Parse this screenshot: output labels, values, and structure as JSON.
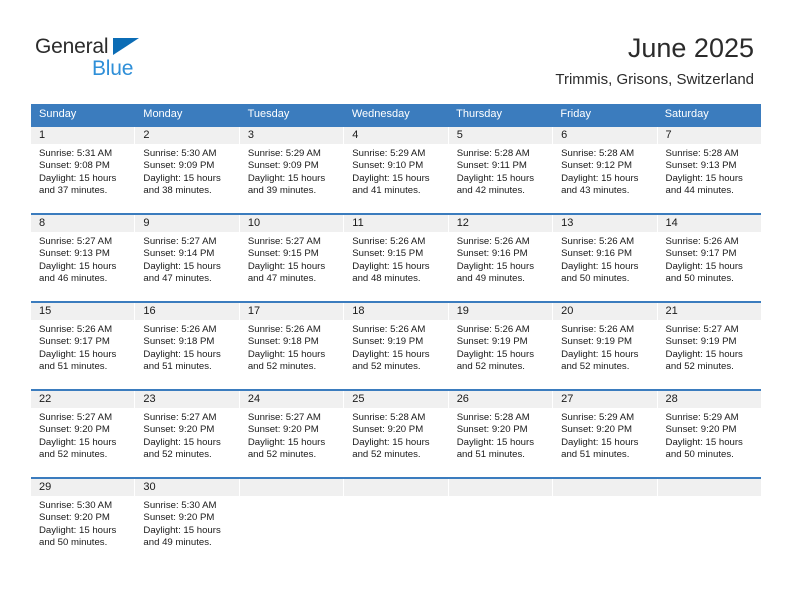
{
  "brand": {
    "name_part1": "General",
    "name_part2": "Blue",
    "triangle_color": "#0b6cb5",
    "blue_text_color": "#2f8fd8"
  },
  "header": {
    "title": "June 2025",
    "subtitle": "Trimmis, Grisons, Switzerland"
  },
  "theme": {
    "header_blue": "#3b7cbe",
    "daynum_band": "#f0f0f0",
    "text": "#1a1a1a"
  },
  "weekdays": [
    "Sunday",
    "Monday",
    "Tuesday",
    "Wednesday",
    "Thursday",
    "Friday",
    "Saturday"
  ],
  "weeks": [
    [
      {
        "day": "1",
        "sunrise": "Sunrise: 5:31 AM",
        "sunset": "Sunset: 9:08 PM",
        "daylight_line1": "Daylight: 15 hours",
        "daylight_line2": "and 37 minutes."
      },
      {
        "day": "2",
        "sunrise": "Sunrise: 5:30 AM",
        "sunset": "Sunset: 9:09 PM",
        "daylight_line1": "Daylight: 15 hours",
        "daylight_line2": "and 38 minutes."
      },
      {
        "day": "3",
        "sunrise": "Sunrise: 5:29 AM",
        "sunset": "Sunset: 9:09 PM",
        "daylight_line1": "Daylight: 15 hours",
        "daylight_line2": "and 39 minutes."
      },
      {
        "day": "4",
        "sunrise": "Sunrise: 5:29 AM",
        "sunset": "Sunset: 9:10 PM",
        "daylight_line1": "Daylight: 15 hours",
        "daylight_line2": "and 41 minutes."
      },
      {
        "day": "5",
        "sunrise": "Sunrise: 5:28 AM",
        "sunset": "Sunset: 9:11 PM",
        "daylight_line1": "Daylight: 15 hours",
        "daylight_line2": "and 42 minutes."
      },
      {
        "day": "6",
        "sunrise": "Sunrise: 5:28 AM",
        "sunset": "Sunset: 9:12 PM",
        "daylight_line1": "Daylight: 15 hours",
        "daylight_line2": "and 43 minutes."
      },
      {
        "day": "7",
        "sunrise": "Sunrise: 5:28 AM",
        "sunset": "Sunset: 9:13 PM",
        "daylight_line1": "Daylight: 15 hours",
        "daylight_line2": "and 44 minutes."
      }
    ],
    [
      {
        "day": "8",
        "sunrise": "Sunrise: 5:27 AM",
        "sunset": "Sunset: 9:13 PM",
        "daylight_line1": "Daylight: 15 hours",
        "daylight_line2": "and 46 minutes."
      },
      {
        "day": "9",
        "sunrise": "Sunrise: 5:27 AM",
        "sunset": "Sunset: 9:14 PM",
        "daylight_line1": "Daylight: 15 hours",
        "daylight_line2": "and 47 minutes."
      },
      {
        "day": "10",
        "sunrise": "Sunrise: 5:27 AM",
        "sunset": "Sunset: 9:15 PM",
        "daylight_line1": "Daylight: 15 hours",
        "daylight_line2": "and 47 minutes."
      },
      {
        "day": "11",
        "sunrise": "Sunrise: 5:26 AM",
        "sunset": "Sunset: 9:15 PM",
        "daylight_line1": "Daylight: 15 hours",
        "daylight_line2": "and 48 minutes."
      },
      {
        "day": "12",
        "sunrise": "Sunrise: 5:26 AM",
        "sunset": "Sunset: 9:16 PM",
        "daylight_line1": "Daylight: 15 hours",
        "daylight_line2": "and 49 minutes."
      },
      {
        "day": "13",
        "sunrise": "Sunrise: 5:26 AM",
        "sunset": "Sunset: 9:16 PM",
        "daylight_line1": "Daylight: 15 hours",
        "daylight_line2": "and 50 minutes."
      },
      {
        "day": "14",
        "sunrise": "Sunrise: 5:26 AM",
        "sunset": "Sunset: 9:17 PM",
        "daylight_line1": "Daylight: 15 hours",
        "daylight_line2": "and 50 minutes."
      }
    ],
    [
      {
        "day": "15",
        "sunrise": "Sunrise: 5:26 AM",
        "sunset": "Sunset: 9:17 PM",
        "daylight_line1": "Daylight: 15 hours",
        "daylight_line2": "and 51 minutes."
      },
      {
        "day": "16",
        "sunrise": "Sunrise: 5:26 AM",
        "sunset": "Sunset: 9:18 PM",
        "daylight_line1": "Daylight: 15 hours",
        "daylight_line2": "and 51 minutes."
      },
      {
        "day": "17",
        "sunrise": "Sunrise: 5:26 AM",
        "sunset": "Sunset: 9:18 PM",
        "daylight_line1": "Daylight: 15 hours",
        "daylight_line2": "and 52 minutes."
      },
      {
        "day": "18",
        "sunrise": "Sunrise: 5:26 AM",
        "sunset": "Sunset: 9:19 PM",
        "daylight_line1": "Daylight: 15 hours",
        "daylight_line2": "and 52 minutes."
      },
      {
        "day": "19",
        "sunrise": "Sunrise: 5:26 AM",
        "sunset": "Sunset: 9:19 PM",
        "daylight_line1": "Daylight: 15 hours",
        "daylight_line2": "and 52 minutes."
      },
      {
        "day": "20",
        "sunrise": "Sunrise: 5:26 AM",
        "sunset": "Sunset: 9:19 PM",
        "daylight_line1": "Daylight: 15 hours",
        "daylight_line2": "and 52 minutes."
      },
      {
        "day": "21",
        "sunrise": "Sunrise: 5:27 AM",
        "sunset": "Sunset: 9:19 PM",
        "daylight_line1": "Daylight: 15 hours",
        "daylight_line2": "and 52 minutes."
      }
    ],
    [
      {
        "day": "22",
        "sunrise": "Sunrise: 5:27 AM",
        "sunset": "Sunset: 9:20 PM",
        "daylight_line1": "Daylight: 15 hours",
        "daylight_line2": "and 52 minutes."
      },
      {
        "day": "23",
        "sunrise": "Sunrise: 5:27 AM",
        "sunset": "Sunset: 9:20 PM",
        "daylight_line1": "Daylight: 15 hours",
        "daylight_line2": "and 52 minutes."
      },
      {
        "day": "24",
        "sunrise": "Sunrise: 5:27 AM",
        "sunset": "Sunset: 9:20 PM",
        "daylight_line1": "Daylight: 15 hours",
        "daylight_line2": "and 52 minutes."
      },
      {
        "day": "25",
        "sunrise": "Sunrise: 5:28 AM",
        "sunset": "Sunset: 9:20 PM",
        "daylight_line1": "Daylight: 15 hours",
        "daylight_line2": "and 52 minutes."
      },
      {
        "day": "26",
        "sunrise": "Sunrise: 5:28 AM",
        "sunset": "Sunset: 9:20 PM",
        "daylight_line1": "Daylight: 15 hours",
        "daylight_line2": "and 51 minutes."
      },
      {
        "day": "27",
        "sunrise": "Sunrise: 5:29 AM",
        "sunset": "Sunset: 9:20 PM",
        "daylight_line1": "Daylight: 15 hours",
        "daylight_line2": "and 51 minutes."
      },
      {
        "day": "28",
        "sunrise": "Sunrise: 5:29 AM",
        "sunset": "Sunset: 9:20 PM",
        "daylight_line1": "Daylight: 15 hours",
        "daylight_line2": "and 50 minutes."
      }
    ],
    [
      {
        "day": "29",
        "sunrise": "Sunrise: 5:30 AM",
        "sunset": "Sunset: 9:20 PM",
        "daylight_line1": "Daylight: 15 hours",
        "daylight_line2": "and 50 minutes."
      },
      {
        "day": "30",
        "sunrise": "Sunrise: 5:30 AM",
        "sunset": "Sunset: 9:20 PM",
        "daylight_line1": "Daylight: 15 hours",
        "daylight_line2": "and 49 minutes."
      },
      {
        "day": "",
        "sunrise": "",
        "sunset": "",
        "daylight_line1": "",
        "daylight_line2": ""
      },
      {
        "day": "",
        "sunrise": "",
        "sunset": "",
        "daylight_line1": "",
        "daylight_line2": ""
      },
      {
        "day": "",
        "sunrise": "",
        "sunset": "",
        "daylight_line1": "",
        "daylight_line2": ""
      },
      {
        "day": "",
        "sunrise": "",
        "sunset": "",
        "daylight_line1": "",
        "daylight_line2": ""
      },
      {
        "day": "",
        "sunrise": "",
        "sunset": "",
        "daylight_line1": "",
        "daylight_line2": ""
      }
    ]
  ]
}
